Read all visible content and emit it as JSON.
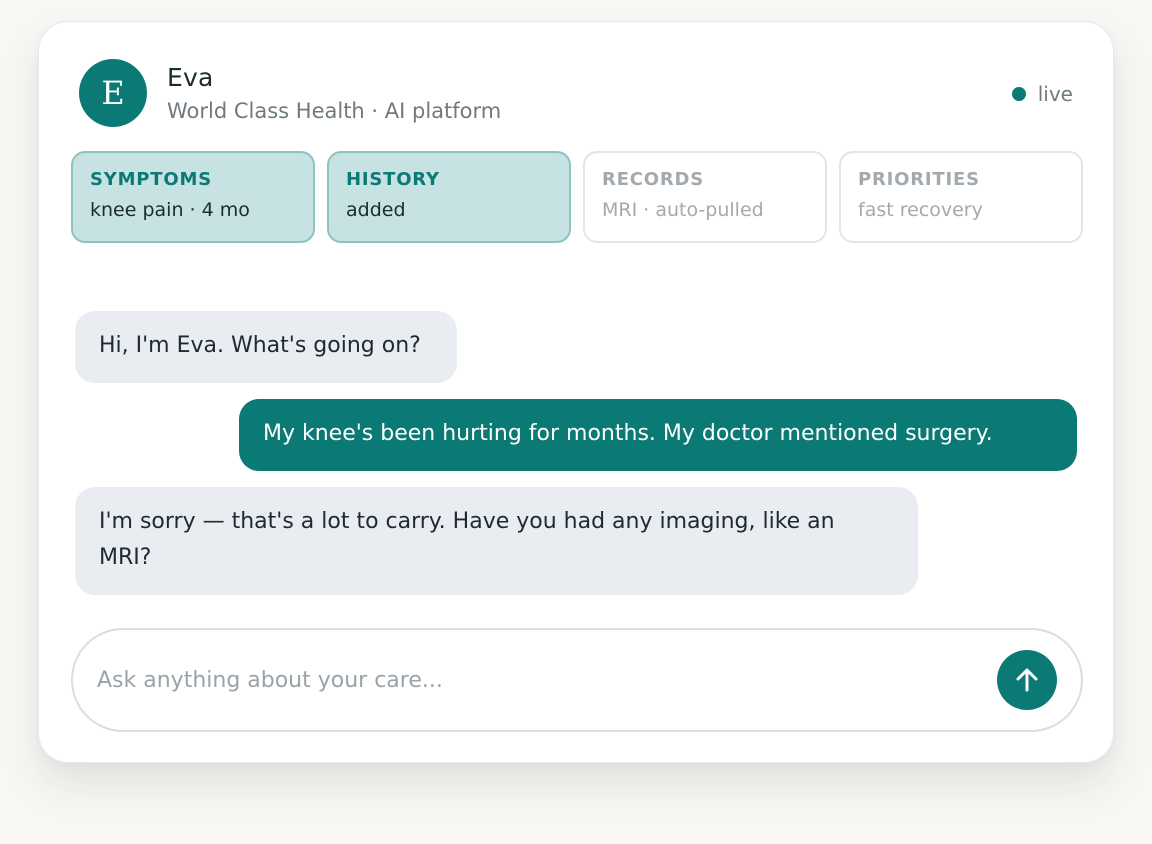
{
  "assistant": {
    "avatar_letter": "E",
    "name": "Eva",
    "subtitle": "World Class Health · AI platform",
    "status": "live"
  },
  "chips": [
    {
      "title": "SYMPTOMS",
      "value": "knee pain · 4 mo",
      "active": true
    },
    {
      "title": "HISTORY",
      "value": "added",
      "active": true
    },
    {
      "title": "RECORDS",
      "value": "MRI · auto-pulled",
      "active": false
    },
    {
      "title": "PRIORITIES",
      "value": "fast recovery",
      "active": false
    }
  ],
  "messages": [
    {
      "role": "assistant",
      "text": "Hi, I'm Eva. What's going on?"
    },
    {
      "role": "user",
      "text": "My knee's been hurting for months. My doctor mentioned surgery."
    },
    {
      "role": "assistant",
      "text": "I'm sorry — that's a lot to carry. Have you had any imaging, like an MRI?"
    }
  ],
  "composer": {
    "placeholder": "Ask anything about your care...",
    "send_icon": "arrow-up-icon"
  },
  "colors": {
    "accent": "#0b7a75",
    "chip_active_bg": "#c6e2e2",
    "bot_bubble": "#e9ecf0"
  }
}
